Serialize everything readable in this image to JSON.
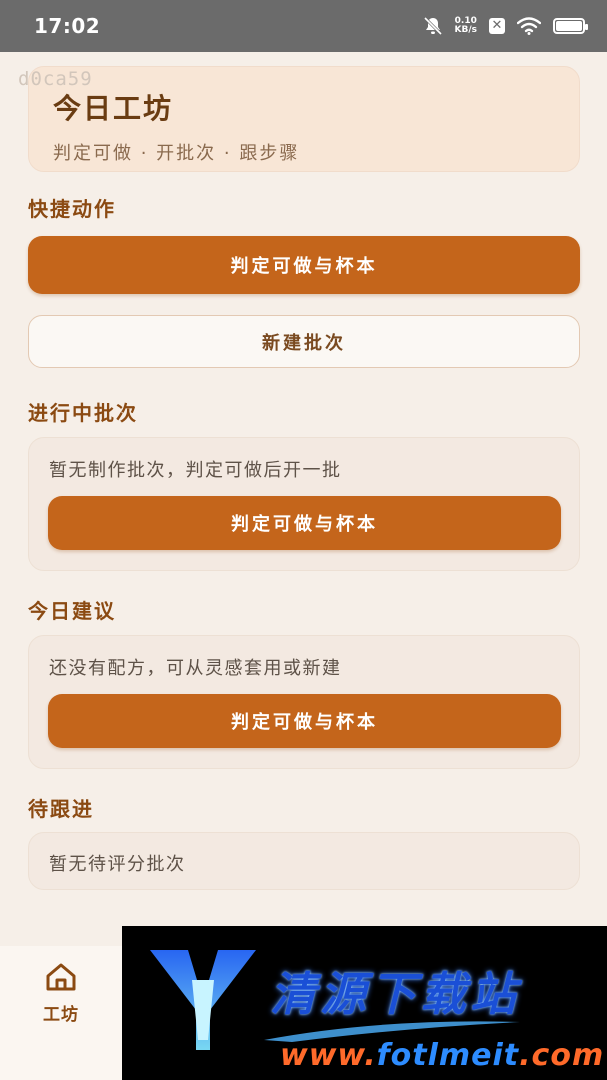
{
  "status_bar": {
    "time": "17:02",
    "net_speed_value": "0.10",
    "net_speed_unit": "KB/s",
    "icons": [
      "mute-bell-icon",
      "x-box-icon",
      "wifi-icon",
      "battery-icon"
    ]
  },
  "watermark_id": "d0ca59",
  "header": {
    "title": "今日工坊",
    "subtitle": "判定可做 · 开批次 · 跟步骤"
  },
  "quick_actions": {
    "title": "快捷动作",
    "primary_label": "判定可做与杯本",
    "secondary_label": "新建批次"
  },
  "in_progress": {
    "title": "进行中批次",
    "empty_text": "暂无制作批次，判定可做后开一批",
    "button_label": "判定可做与杯本"
  },
  "suggestions": {
    "title": "今日建议",
    "empty_text": "还没有配方，可从灵感套用或新建",
    "button_label": "判定可做与杯本"
  },
  "follow_up": {
    "title": "待跟进",
    "empty_text": "暂无待评分批次"
  },
  "bottom_nav": {
    "items": [
      {
        "label": "工坊",
        "icon": "home-icon",
        "active": true
      }
    ]
  },
  "ad_overlay": {
    "title": "清源下载站",
    "url_prefix": "www.",
    "url_domain": "fotlmeit",
    "url_suffix": ".com"
  },
  "colors": {
    "accent": "#c4651b",
    "section_title": "#8b4a12",
    "background": "#f6efe8",
    "header_card": "#f8e6d6"
  }
}
